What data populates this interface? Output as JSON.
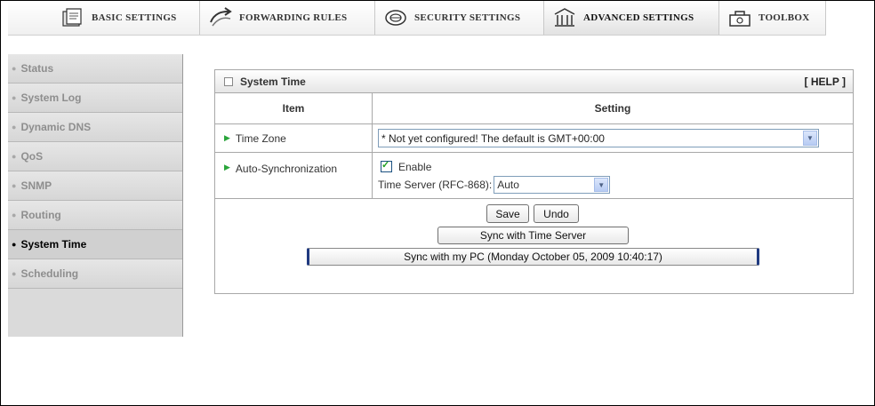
{
  "nav": {
    "tabs": [
      {
        "label": "BASIC SETTINGS",
        "icon": "document-folder-icon"
      },
      {
        "label": "FORWARDING RULES",
        "icon": "forwarding-arrows-icon"
      },
      {
        "label": "SECURITY SETTINGS",
        "icon": "security-disc-icon"
      },
      {
        "label": "ADVANCED SETTINGS",
        "icon": "advanced-temple-icon",
        "active": true
      },
      {
        "label": "TOOLBOX",
        "icon": "toolbox-icon"
      }
    ]
  },
  "sidebar": {
    "items": [
      {
        "label": "Status"
      },
      {
        "label": "System Log"
      },
      {
        "label": "Dynamic DNS"
      },
      {
        "label": "QoS"
      },
      {
        "label": "SNMP"
      },
      {
        "label": "Routing"
      },
      {
        "label": "System Time",
        "active": true
      },
      {
        "label": "Scheduling"
      }
    ]
  },
  "panel": {
    "title": "System Time",
    "help": "[ HELP ]",
    "col_item": "Item",
    "col_setting": "Setting",
    "time_zone": {
      "label": "Time Zone",
      "value": "* Not yet configured! The default is GMT+00:00"
    },
    "auto_sync": {
      "label": "Auto-Synchronization",
      "enable_label": "Enable",
      "enabled": true,
      "server_label": "Time Server (RFC-868):",
      "server_value": "Auto"
    },
    "buttons": {
      "save": "Save",
      "undo": "Undo",
      "sync_server": "Sync with Time Server",
      "sync_pc": "Sync with my PC (Monday October 05, 2009 10:40:17)"
    }
  },
  "colors": {
    "sidebar_bg": "#dadada",
    "arrow_green": "#2aa53b",
    "select_border": "#7f9db9"
  }
}
